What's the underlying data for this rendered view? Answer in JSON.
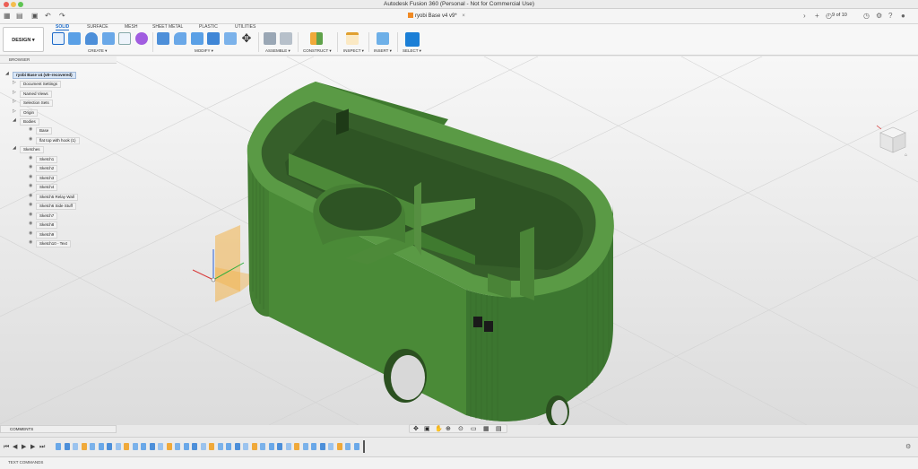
{
  "window": {
    "title": "Autodesk Fusion 360 (Personal - Not for Commercial Use)"
  },
  "document_tab": {
    "name": "ryobi Base v4 v9*"
  },
  "header_right": {
    "page_count": "9 of 10"
  },
  "workspace": {
    "label": "DESIGN ▾"
  },
  "tabs": [
    {
      "label": "SOLID"
    },
    {
      "label": "SURFACE"
    },
    {
      "label": "MESH"
    },
    {
      "label": "SHEET METAL"
    },
    {
      "label": "PLASTIC"
    },
    {
      "label": "UTILITIES"
    }
  ],
  "tool_groups": {
    "create": "CREATE ▾",
    "modify": "MODIFY ▾",
    "assemble": "ASSEMBLE ▾",
    "construct": "CONSTRUCT ▾",
    "inspect": "INSPECT ▾",
    "insert": "INSERT ▾",
    "select": "SELECT ▾"
  },
  "browser": {
    "title": "BROWSER",
    "root": "ryobi Base v4 (v8~recovered)",
    "items": [
      {
        "label": "Document Settings"
      },
      {
        "label": "Named Views"
      },
      {
        "label": "Selection Sets"
      },
      {
        "label": "Origin"
      },
      {
        "label": "Bodies"
      },
      {
        "label": "Base"
      },
      {
        "label": "flat top with hook (1)"
      },
      {
        "label": "Sketches"
      },
      {
        "label": "Sketch1"
      },
      {
        "label": "Sketch2"
      },
      {
        "label": "Sketch3"
      },
      {
        "label": "Sketch4"
      },
      {
        "label": "Sketch5 Relay Wall"
      },
      {
        "label": "Sketch6 Side Stuff"
      },
      {
        "label": "Sketch7"
      },
      {
        "label": "Sketch8"
      },
      {
        "label": "Sketch9"
      },
      {
        "label": "Sketch10 - Text"
      }
    ]
  },
  "comments": {
    "label": "COMMENTS"
  },
  "text_commands": {
    "label": "TEXT COMMANDS"
  },
  "colors": {
    "model_green": "#3f7a2f",
    "model_dark": "#2c5a20",
    "accent_blue": "#1b6ac9",
    "plane_orange": "#f2b24a"
  }
}
